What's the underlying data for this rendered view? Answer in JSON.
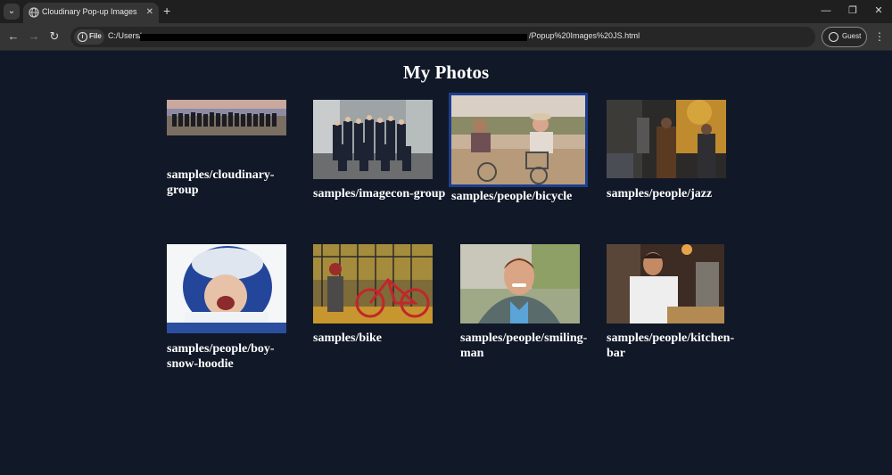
{
  "browser": {
    "tab_title": "Cloudinary Pop-up Images",
    "site_label": "File",
    "url_start": "C:/Users/",
    "url_end": "/Popup%20Images%20JS.html",
    "guest_label": "Guest"
  },
  "page": {
    "title": "My Photos"
  },
  "photos": [
    {
      "caption": "samples/cloudinary-group"
    },
    {
      "caption": "samples/imagecon-group"
    },
    {
      "caption": "samples/people/bicycle"
    },
    {
      "caption": "samples/people/jazz"
    },
    {
      "caption": "samples/people/boy-snow-hoodie"
    },
    {
      "caption": "samples/bike"
    },
    {
      "caption": "samples/people/smiling-man"
    },
    {
      "caption": "samples/people/kitchen-bar"
    }
  ]
}
